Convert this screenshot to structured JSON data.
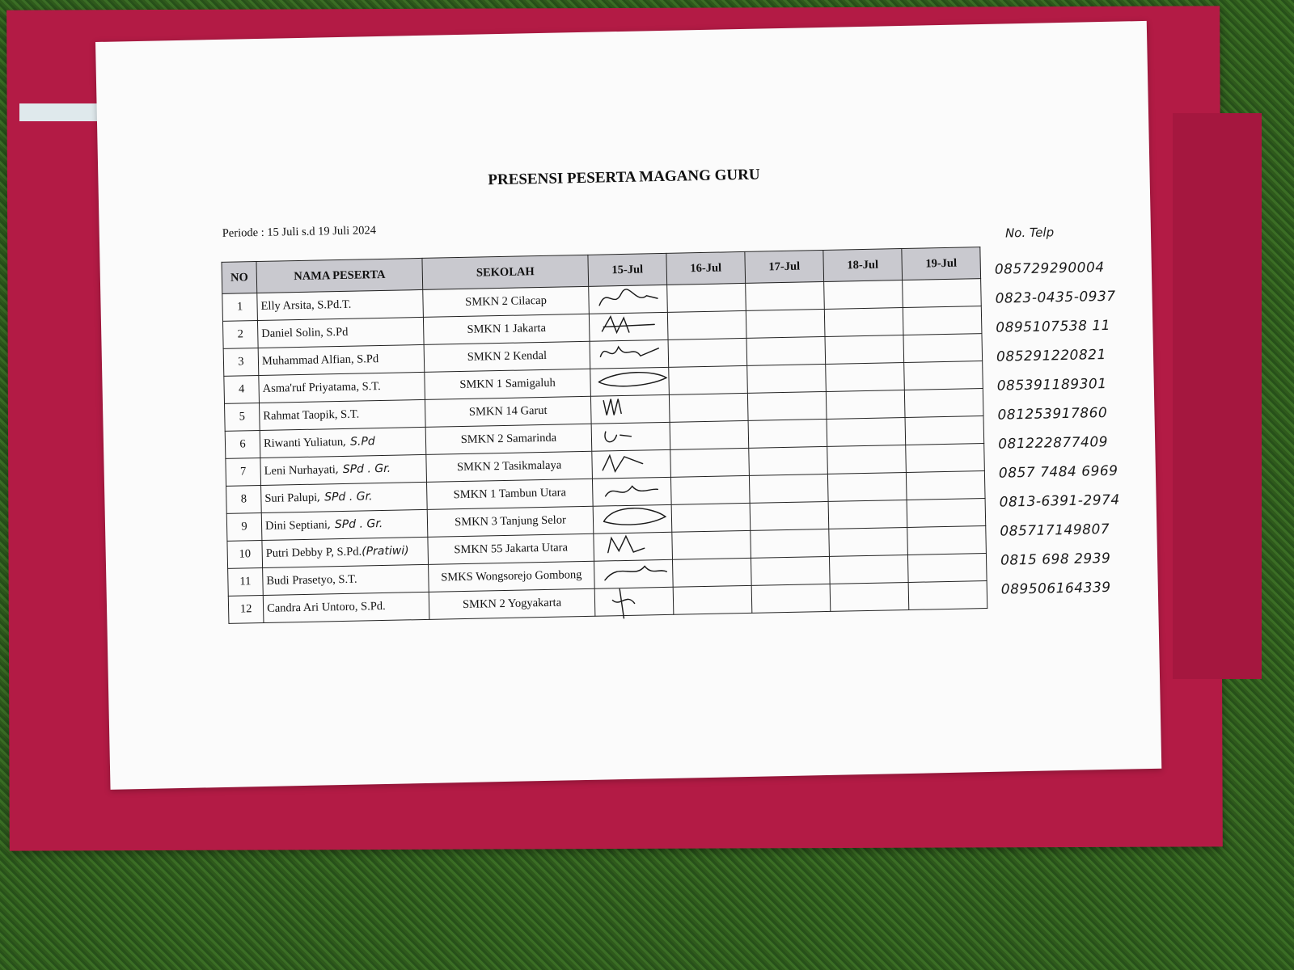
{
  "document": {
    "title": "PRESENSI PESERTA MAGANG GURU",
    "periode": "Periode : 15 Juli s.d 19 Juli 2024"
  },
  "table": {
    "headers": [
      "NO",
      "NAMA PESERTA",
      "SEKOLAH",
      "15-Jul",
      "16-Jul",
      "17-Jul",
      "18-Jul",
      "19-Jul"
    ],
    "rows": [
      {
        "no": "1",
        "name": "Elly Arsita, S.Pd.T.",
        "name_hw": "",
        "school": "SMKN 2 Cilacap"
      },
      {
        "no": "2",
        "name": "Daniel Solin, S.Pd",
        "name_hw": "",
        "school": "SMKN 1 Jakarta"
      },
      {
        "no": "3",
        "name": "Muhammad Alfian, S.Pd",
        "name_hw": "",
        "school": "SMKN 2 Kendal"
      },
      {
        "no": "4",
        "name": "Asma'ruf Priyatama, S.T.",
        "name_hw": "",
        "school": "SMKN 1 Samigaluh"
      },
      {
        "no": "5",
        "name": "Rahmat Taopik, S.T.",
        "name_hw": "",
        "school": "SMKN 14 Garut"
      },
      {
        "no": "6",
        "name": "Riwanti Yuliatun",
        "name_hw": ", S.Pd",
        "school": "SMKN 2 Samarinda"
      },
      {
        "no": "7",
        "name": "Leni Nurhayati",
        "name_hw": ", SPd . Gr.",
        "school": "SMKN 2 Tasikmalaya"
      },
      {
        "no": "8",
        "name": "Suri Palupi",
        "name_hw": ", SPd . Gr.",
        "school": "SMKN 1 Tambun Utara"
      },
      {
        "no": "9",
        "name": "Dini Septiani",
        "name_hw": ", SPd . Gr.",
        "school": "SMKN 3 Tanjung Selor"
      },
      {
        "no": "10",
        "name": "Putri Debby P, S.Pd.",
        "name_hw": "(Pratiwi)",
        "school": "SMKN 55 Jakarta Utara"
      },
      {
        "no": "11",
        "name": "Budi Prasetyo, S.T.",
        "name_hw": "",
        "school": "SMKS Wongsorejo Gombong"
      },
      {
        "no": "12",
        "name": "Candra Ari Untoro, S.Pd.",
        "name_hw": "",
        "school": "SMKN 2 Yogyakarta"
      }
    ]
  },
  "phones": {
    "header": "No. Telp",
    "numbers": [
      "085729290004",
      "0823-0435-0937",
      "0895107538 11",
      "085291220821",
      "085391189301",
      "081253917860",
      "081222877409",
      "0857 7484 6969",
      "0813-6391-2974",
      "085717149807",
      "0815 698 2939",
      "089506164339"
    ]
  }
}
